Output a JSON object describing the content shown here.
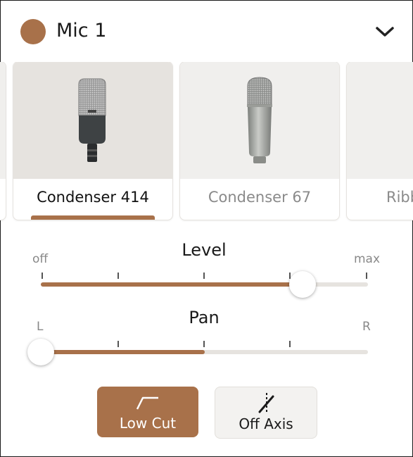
{
  "colors": {
    "accent": "#a8714a",
    "track": "#e6e3df"
  },
  "header": {
    "title": "Mic 1",
    "icon": "chevron-down-icon"
  },
  "mics": [
    {
      "label": "",
      "partial": true
    },
    {
      "label": "Condenser 414",
      "selected": true
    },
    {
      "label": "Condenser 67",
      "selected": false
    },
    {
      "label": "Ribbon",
      "selected": false,
      "partial": true
    }
  ],
  "level": {
    "title": "Level",
    "min_label": "off",
    "max_label": "max",
    "value": 0.8
  },
  "pan": {
    "title": "Pan",
    "left_label": "L",
    "right_label": "R",
    "value": -1.0
  },
  "buttons": {
    "low_cut": {
      "label": "Low Cut",
      "active": true
    },
    "off_axis": {
      "label": "Off Axis",
      "active": false
    }
  }
}
